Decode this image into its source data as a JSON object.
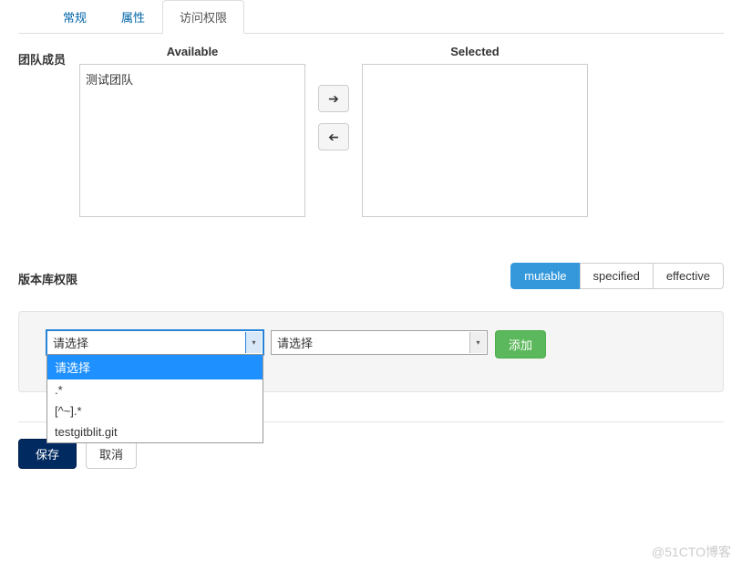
{
  "tabs": {
    "general": "常规",
    "properties": "属性",
    "access": "访问权限"
  },
  "team": {
    "label": "团队成员",
    "available_header": "Available",
    "selected_header": "Selected",
    "available_items": [
      "测试团队"
    ]
  },
  "perm": {
    "label": "版本库权限",
    "segments": {
      "mutable": "mutable",
      "specified": "specified",
      "effective": "effective"
    }
  },
  "form": {
    "select1_value": "请选择",
    "select1_options": [
      "请选择",
      ".*",
      "[^~].*",
      "testgitblit.git"
    ],
    "select2_value": "请选择",
    "add_button": "添加"
  },
  "footer": {
    "save": "保存",
    "cancel": "取消"
  },
  "watermark": "@51CTO博客"
}
